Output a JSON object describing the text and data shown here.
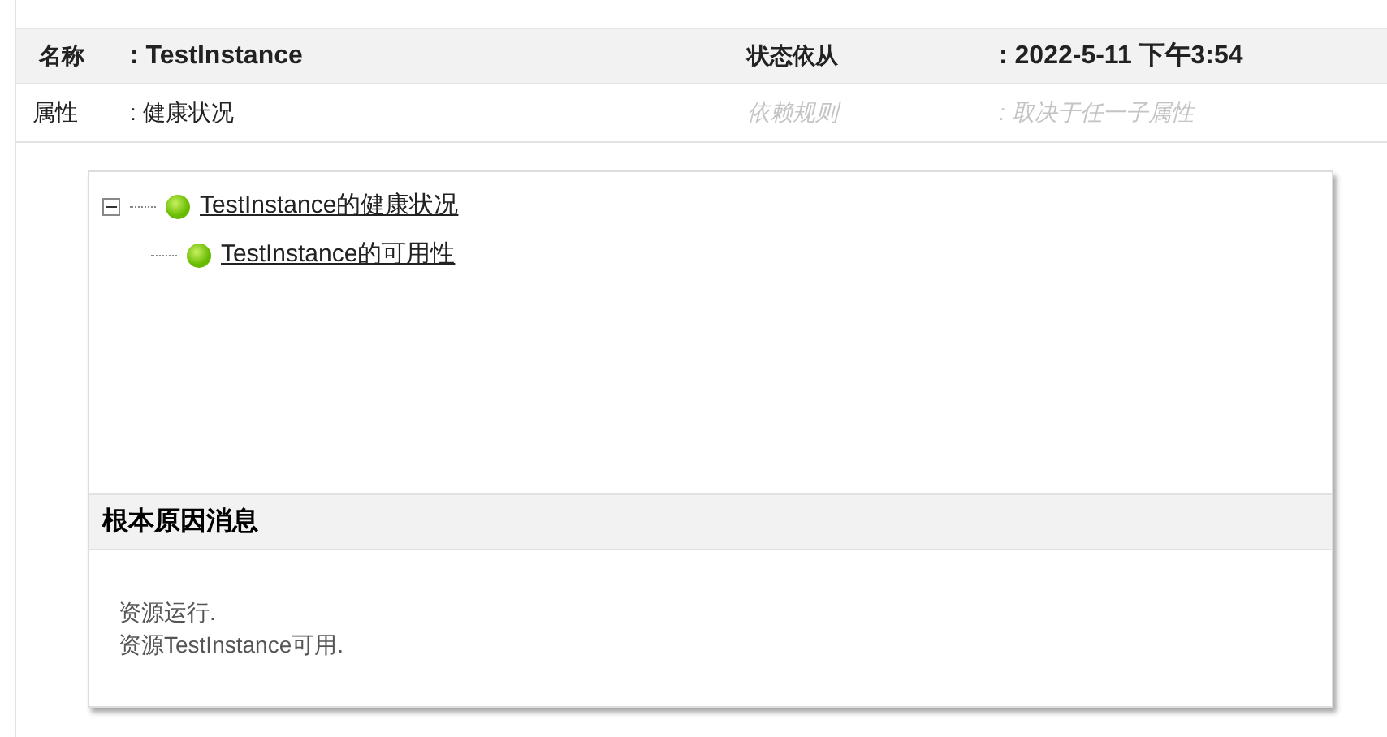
{
  "header": {
    "name_label": "名称",
    "name_value": ": TestInstance",
    "state_label": "状态依从",
    "state_value": ": 2022-5-11 下午3:54"
  },
  "attribute_row": {
    "label": "属性",
    "value": ": 健康状况",
    "rule_label": "依赖规则",
    "rule_value": ": 取决于任一子属性"
  },
  "tree": [
    {
      "label": "TestInstance的健康状况",
      "color": "#66bb00",
      "expanded": true,
      "children": [
        {
          "label": "TestInstance的可用性",
          "color": "#66bb00"
        }
      ]
    }
  ],
  "root_cause": {
    "title": "根本原因消息",
    "lines": [
      "资源运行.",
      "资源TestInstance可用."
    ]
  }
}
